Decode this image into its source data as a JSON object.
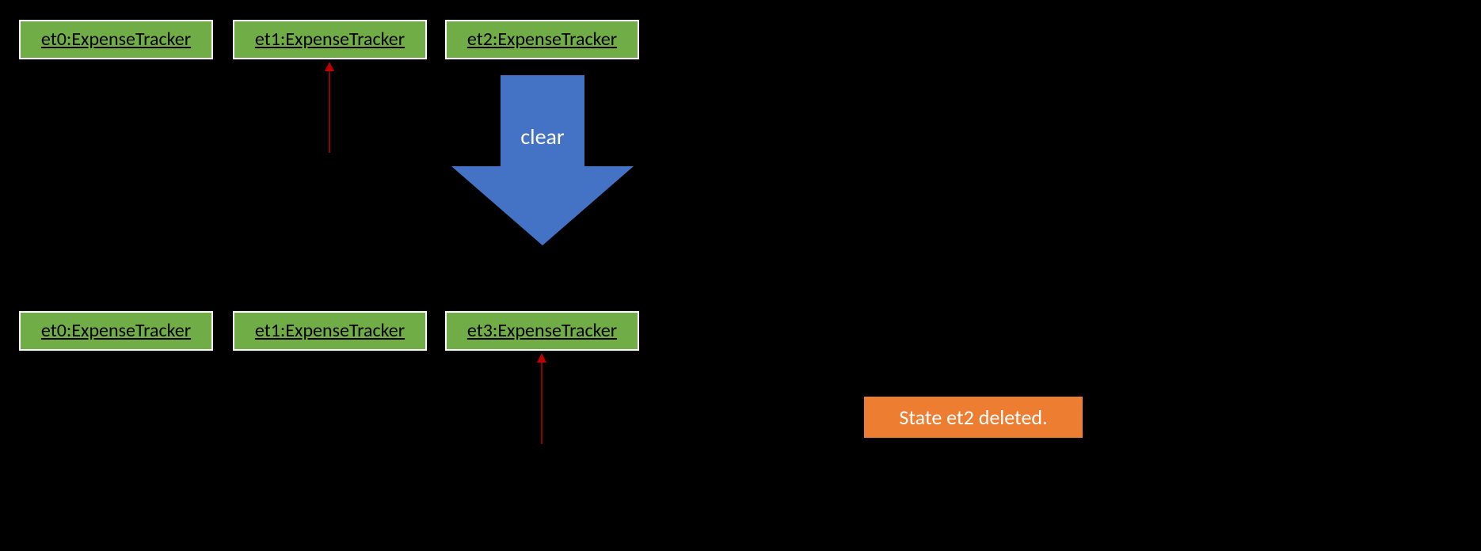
{
  "top_row": {
    "et0": "et0:ExpenseTracker",
    "et1": "et1:ExpenseTracker",
    "et2": "et2:ExpenseTracker"
  },
  "bottom_row": {
    "et0": "et0:ExpenseTracker",
    "et1": "et1:ExpenseTracker",
    "et3": "et3:ExpenseTracker"
  },
  "arrow_label": "clear",
  "status_message": "State et2 deleted.",
  "colors": {
    "object_fill": "#70AD47",
    "object_border": "#FFFFFF",
    "big_arrow": "#4472C4",
    "red_arrow": "#C00000",
    "status_fill": "#ED7D31",
    "background": "#000000"
  }
}
